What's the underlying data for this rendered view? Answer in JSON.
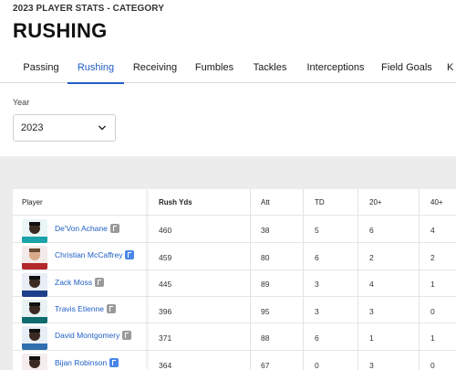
{
  "header": {
    "kicker": "2023 PLAYER STATS - CATEGORY",
    "title": "RUSHING"
  },
  "tabs": [
    {
      "label": "Passing",
      "active": false
    },
    {
      "label": "Rushing",
      "active": true
    },
    {
      "label": "Receiving",
      "active": false
    },
    {
      "label": "Fumbles",
      "active": false
    },
    {
      "label": "Tackles",
      "active": false
    },
    {
      "label": "Interceptions",
      "active": false
    },
    {
      "label": "Field Goals",
      "active": false
    },
    {
      "label": "K",
      "active": false
    }
  ],
  "filter": {
    "year_label": "Year",
    "year_value": "2023"
  },
  "table": {
    "columns": [
      "Player",
      "Rush Yds",
      "Att",
      "TD",
      "20+",
      "40+"
    ],
    "rows": [
      {
        "player": "De'Von Achane",
        "rush_yds": "460",
        "att": "38",
        "td": "5",
        "twenty": "6",
        "forty": "4"
      },
      {
        "player": "Christian McCaffrey",
        "rush_yds": "459",
        "att": "80",
        "td": "6",
        "twenty": "2",
        "forty": "2"
      },
      {
        "player": "Zack Moss",
        "rush_yds": "445",
        "att": "89",
        "td": "3",
        "twenty": "4",
        "forty": "1"
      },
      {
        "player": "Travis Etienne",
        "rush_yds": "396",
        "att": "95",
        "td": "3",
        "twenty": "3",
        "forty": "0"
      },
      {
        "player": "David Montgomery",
        "rush_yds": "371",
        "att": "88",
        "td": "6",
        "twenty": "1",
        "forty": "1"
      },
      {
        "player": "Bijan Robinson",
        "rush_yds": "364",
        "att": "67",
        "td": "0",
        "twenty": "3",
        "forty": "0"
      }
    ]
  },
  "colors": {
    "accent": "#1f5fc4",
    "band": "#ececec"
  }
}
